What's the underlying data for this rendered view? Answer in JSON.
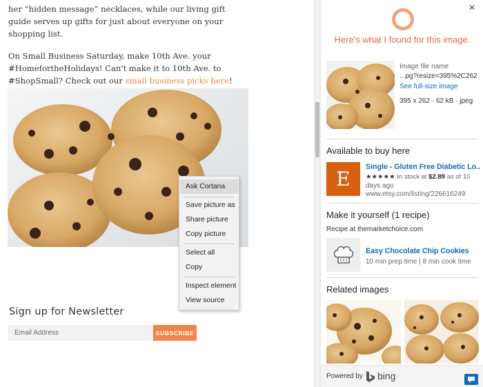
{
  "article": {
    "line1": "her “hidden message” necklaces, while our living gift guide serves up gifts for just about everyone on your shopping list.",
    "line2_prefix": "On Small Business Saturday, make 10th Ave. your #HomefortheHolidays! Can't make it to 10th Ave. to #ShopSmall? Check out our ",
    "line2_link": "small business picks here",
    "line2_suffix": "!"
  },
  "newsletter": {
    "title": "Sign up for Newsletter",
    "placeholder": "Email Address",
    "button": "SUBSCRIBE"
  },
  "context_menu": {
    "items": [
      "Ask Cortana",
      "Save picture as",
      "Share picture",
      "Copy picture",
      "Select all",
      "Copy",
      "Inspect element",
      "View source"
    ]
  },
  "cortana": {
    "heading": "Here's what I found for this image.",
    "close_icon": "×",
    "image_info": {
      "label": "Image file name",
      "file": "...pg?resize=395%2C262",
      "link": "See full-size image",
      "dims": "395 x 262 · 62 kB · jpeg"
    },
    "buy": {
      "title": "Available to buy here",
      "logo": "E",
      "listing_title": "Single - Gluten Free Diabetic Lo...",
      "stars": "★★★★★",
      "stock_prefix": "In stock at ",
      "price": "$2.89",
      "stock_suffix": " as of 10",
      "age": "days ago",
      "url": "www.etsy.com/listing/226616249"
    },
    "recipe": {
      "title": "Make it yourself (1 recipe)",
      "source": "Recipe at themarketchoice.com",
      "name": "Easy Chocolate Chip Cookies",
      "time": "10 min prep time | 8 min cook time"
    },
    "related": {
      "title": "Related images"
    },
    "footer": {
      "powered": "Powered by",
      "brand": "bing"
    }
  },
  "colors": {
    "accent_orange": "#e8693e",
    "link_blue": "#0f6cbd",
    "subscribe": "#f0854a",
    "etsy": "#d5600f"
  },
  "icons": [
    "cortana-ring-icon",
    "close-icon",
    "chef-hat-icon",
    "bing-logo-icon",
    "feedback-icon"
  ]
}
